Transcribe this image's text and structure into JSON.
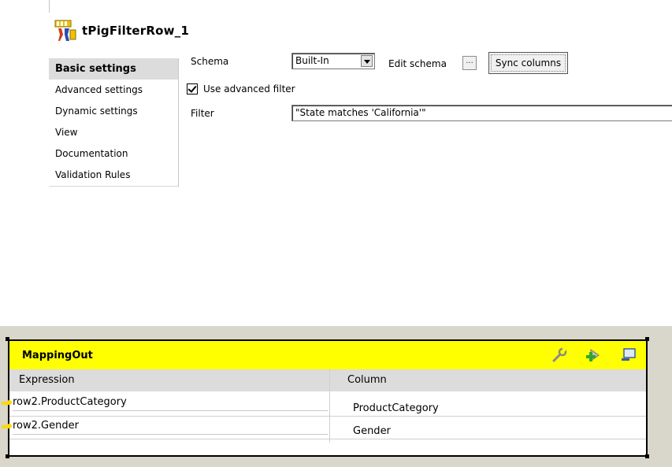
{
  "component": {
    "title": "tPigFilterRow_1",
    "icon": "pig-filter-component-icon"
  },
  "menu": {
    "items": [
      {
        "label": "Basic settings",
        "active": true
      },
      {
        "label": "Advanced settings"
      },
      {
        "label": "Dynamic settings"
      },
      {
        "label": "View"
      },
      {
        "label": "Documentation"
      },
      {
        "label": "Validation Rules"
      }
    ]
  },
  "settings": {
    "schema_label": "Schema",
    "schema_value": "Built-In",
    "edit_schema_label": "Edit schema",
    "edit_schema_button": "...",
    "sync_columns_label": "Sync columns",
    "use_advanced_filter_label": "Use advanced filter",
    "use_advanced_filter_checked": true,
    "filter_label": "Filter",
    "filter_value": "\"State matches 'California'\""
  },
  "mapping": {
    "title": "MappingOut",
    "header_icons": [
      "wrench-icon",
      "add-column-icon",
      "minimize-icon"
    ],
    "expression_header": "Expression",
    "column_header": "Column",
    "rows": [
      {
        "expression": "row2.ProductCategory",
        "column": "ProductCategory"
      },
      {
        "expression": "row2.Gender",
        "column": "Gender"
      }
    ],
    "colors": {
      "header": "#ffff00",
      "connector": "#ffd800"
    }
  }
}
